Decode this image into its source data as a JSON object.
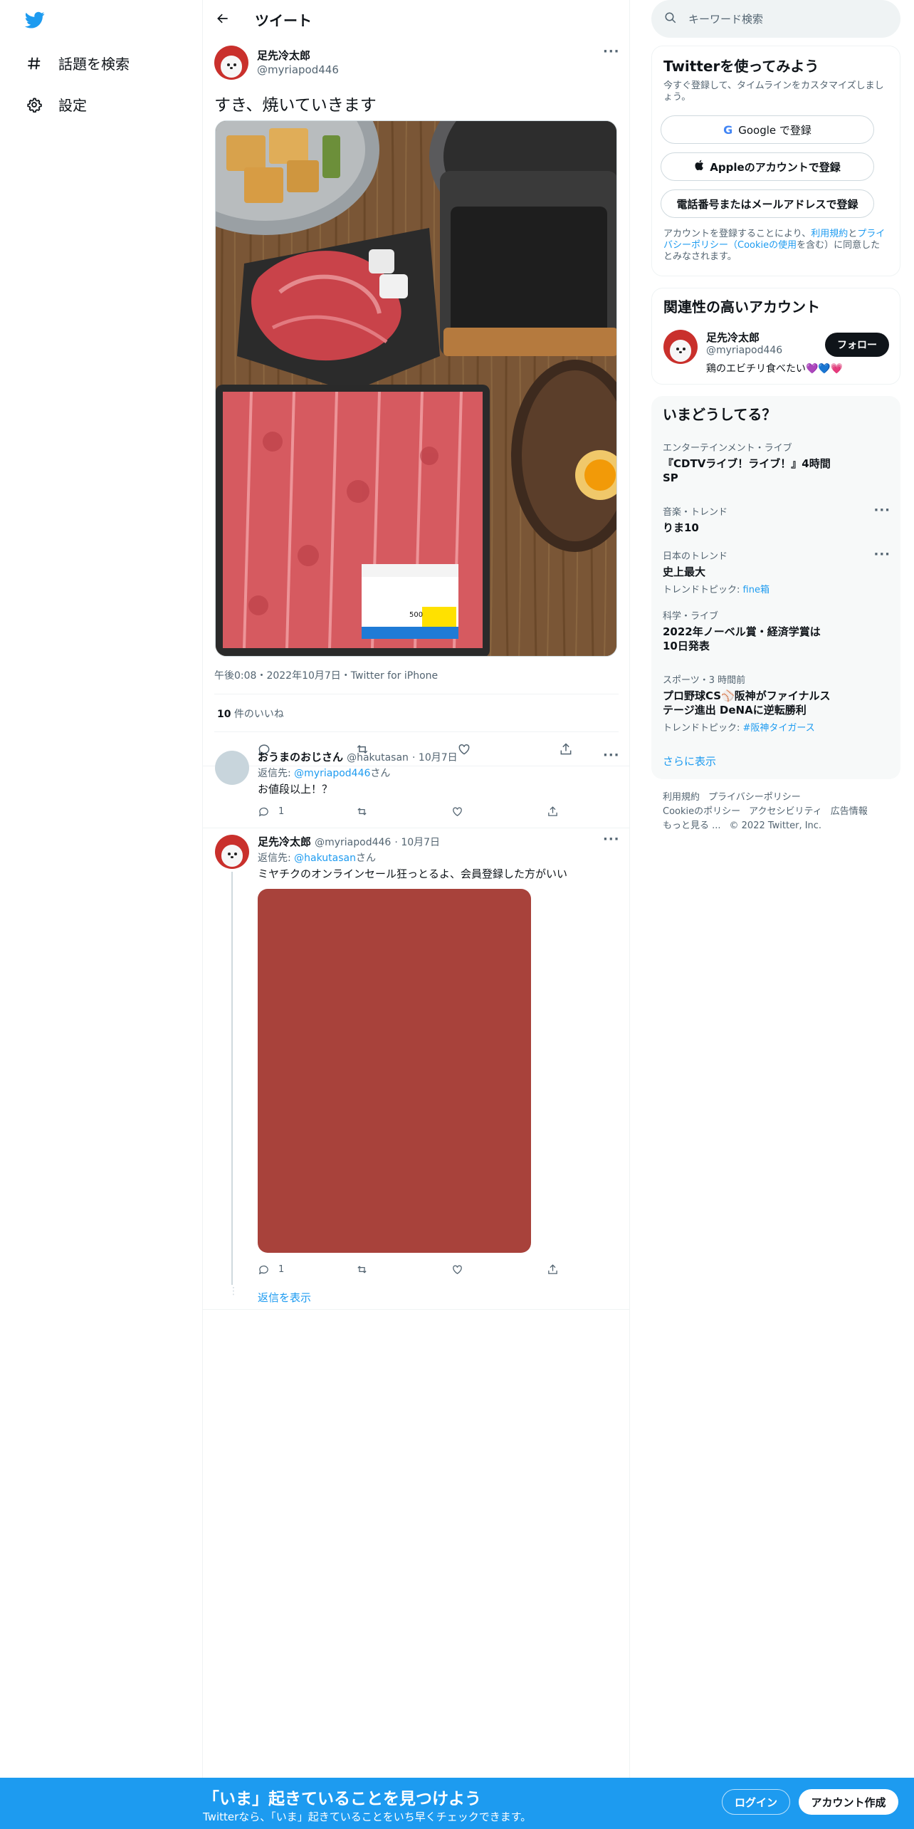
{
  "nav": {
    "items": [
      {
        "label": "話題を検索",
        "icon": "hashtag-icon"
      },
      {
        "label": "設定",
        "icon": "gear-icon"
      }
    ]
  },
  "header": {
    "title": "ツイート"
  },
  "tweet": {
    "author_name": "足先冷太郎",
    "author_handle": "@myriapod446",
    "text": "すき、焼いていきます",
    "meta": "午後0:08・2022年10月7日・Twitter for iPhone",
    "likes_count": "10",
    "likes_label": " 件のいいね",
    "label_sticker": {
      "price": "500"
    }
  },
  "replies": [
    {
      "name": "おうまのおじさん",
      "handle": "@hakutasan",
      "date": "· 10月7日",
      "reply_to_label": "返信先: ",
      "reply_to": "@myriapod446",
      "reply_to_suffix": "さん",
      "text": "お値段以上！？",
      "reply_count": "1"
    },
    {
      "name": "足先冷太郎",
      "handle": "@myriapod446",
      "date": "· 10月7日",
      "reply_to_label": "返信先: ",
      "reply_to": "@hakutasan",
      "reply_to_suffix": "さん",
      "text": "ミヤチクのオンラインセール狂っとるよ、会員登録した方がいい",
      "reply_count": "1",
      "media_color": "#a8423b"
    }
  ],
  "show_replies": "返信を表示",
  "search": {
    "placeholder": "キーワード検索"
  },
  "signup_card": {
    "title": "Twitterを使ってみよう",
    "subtitle": "今すぐ登録して、タイムラインをカスタマイズしましょう。",
    "google": "Google で登録",
    "apple": "Appleのアカウントで登録",
    "phone": "電話番号またはメールアドレスで登録",
    "tos_1": "アカウントを登録することにより、",
    "tos_link1": "利用規約",
    "tos_2": "と",
    "tos_link2": "プライバシーポリシー（Cookieの使用",
    "tos_3": "を含む）に同意したとみなされます。"
  },
  "related": {
    "title": "関連性の高いアカウント",
    "name": "足先冷太郎",
    "handle": "@myriapod446",
    "bio": "鶏のエビチリ食べたい💜💙💗",
    "follow": "フォロー"
  },
  "trends": {
    "title": "いまどうしてる？",
    "items": [
      {
        "category": "エンターテインメント・ライブ",
        "name": "『CDTVライブ！ライブ！』4時間SP",
        "sub": "",
        "sub_link": ""
      },
      {
        "category": "音楽・トレンド",
        "name": "りま10",
        "sub": "",
        "sub_link": ""
      },
      {
        "category": "日本のトレンド",
        "name": "史上最大",
        "sub": "トレンドトピック: ",
        "sub_link": "fine箱"
      },
      {
        "category": "科学・ライブ",
        "name": "2022年ノーベル賞・経済学賞は10日発表",
        "sub": "",
        "sub_link": ""
      },
      {
        "category": "スポーツ・3 時間前",
        "name": "プロ野球CS⚾阪神がファイナルステージ進出 DeNAに逆転勝利",
        "sub": "トレンドトピック: ",
        "sub_link": "#阪神タイガース"
      }
    ],
    "show_more": "さらに表示"
  },
  "footer": {
    "links": [
      "利用規約",
      "プライバシーポリシー",
      "Cookieのポリシー",
      "アクセシビリティ",
      "広告情報",
      "もっと見る ..."
    ],
    "copyright": "© 2022 Twitter, Inc."
  },
  "bottom_bar": {
    "title": "「いま」起きていることを見つけよう",
    "subtitle": "Twitterなら、「いま」起きていることをいち早くチェックできます。",
    "login": "ログイン",
    "signup": "アカウント作成"
  },
  "colors": {
    "accent": "#1d9bf0",
    "dark": "#0f1419",
    "muted": "#536471"
  }
}
